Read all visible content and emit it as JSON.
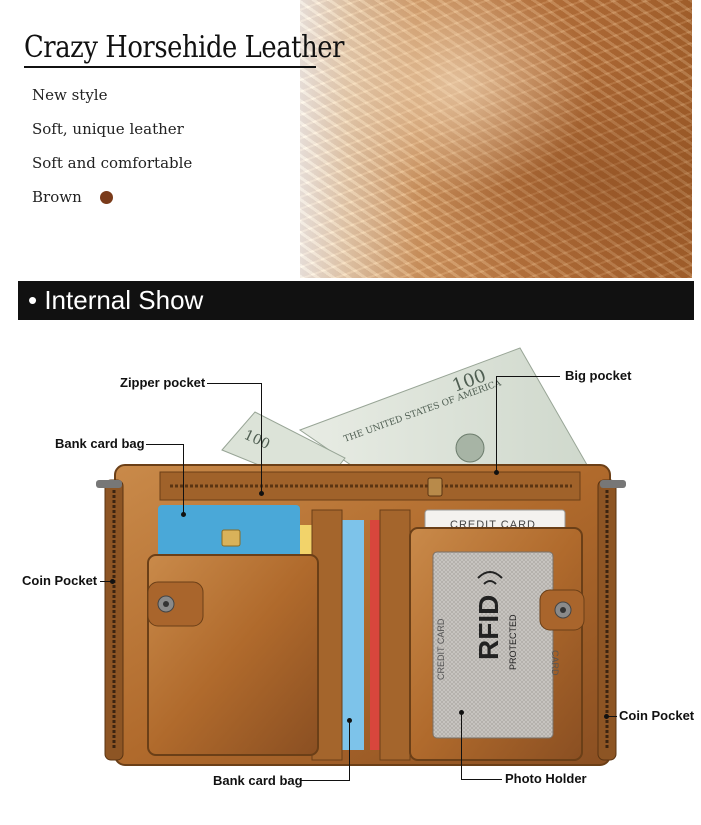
{
  "header": {
    "title": "Crazy Horsehide Leather",
    "features": [
      "New style",
      "Soft, unique leather",
      "Soft and comfortable",
      "Brown"
    ],
    "swatch_color": "#7a3b1a"
  },
  "section": {
    "title": "• Internal Show"
  },
  "callouts": {
    "zipper_pocket": "Zipper pocket",
    "big_pocket": "Big pocket",
    "bank_card_bag_top": "Bank card bag",
    "coin_pocket_left": "Coin Pocket",
    "coin_pocket_right": "Coin Pocket",
    "bank_card_bag_bottom": "Bank card bag",
    "photo_holder": "Photo Holder"
  },
  "product": {
    "credit_card_label": "CREDIT CARD",
    "rfid_text": "RFID",
    "rfid_sub": "PROTECTED",
    "side_text_left": "CREDIT CARD",
    "side_text_right": "CARD",
    "bill_number": "100",
    "bill_text": "THE UNITED STATES OF AMERICA"
  },
  "colors": {
    "leather": "#b5712f",
    "leather_dark": "#7a4a1e",
    "bar": "#111111"
  }
}
